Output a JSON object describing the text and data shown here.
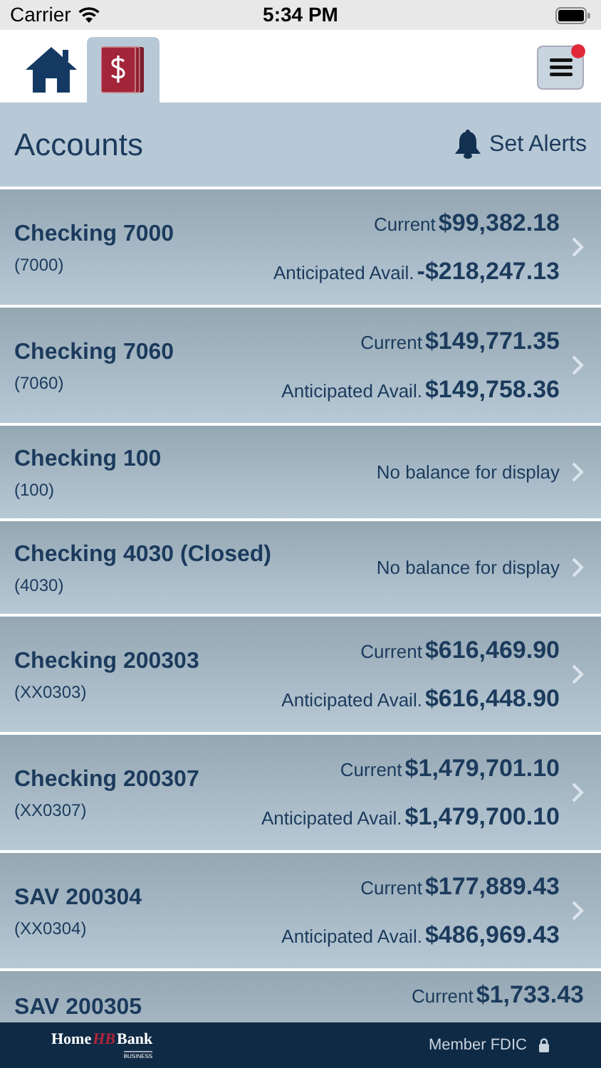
{
  "status_bar": {
    "carrier": "Carrier",
    "time": "5:34 PM"
  },
  "nav": {
    "tabs": [
      {
        "kind": "home",
        "selected": false
      },
      {
        "kind": "accounts",
        "selected": true
      }
    ],
    "menu": {
      "notification": true
    }
  },
  "header": {
    "title": "Accounts",
    "alerts_label": "Set Alerts"
  },
  "accounts": [
    {
      "kind": "balances",
      "name": "Checking 7000",
      "number": "(7000)",
      "current_label": "Current",
      "current": "$99,382.18",
      "anticipated_label": "Anticipated Avail.",
      "anticipated": "-$218,247.13"
    },
    {
      "kind": "balances",
      "name": "Checking 7060",
      "number": "(7060)",
      "current_label": "Current",
      "current": "$149,771.35",
      "anticipated_label": "Anticipated Avail.",
      "anticipated": "$149,758.36"
    },
    {
      "kind": "message",
      "name": "Checking 100",
      "number": "(100)",
      "message": "No balance for display"
    },
    {
      "kind": "message",
      "name": "Checking 4030 (Closed)",
      "number": "(4030)",
      "message": "No balance for display"
    },
    {
      "kind": "balances",
      "name": "Checking 200303",
      "number": "(XX0303)",
      "current_label": "Current",
      "current": "$616,469.90",
      "anticipated_label": "Anticipated Avail.",
      "anticipated": "$616,448.90"
    },
    {
      "kind": "balances",
      "name": "Checking 200307",
      "number": "(XX0307)",
      "current_label": "Current",
      "current": "$1,479,701.10",
      "anticipated_label": "Anticipated Avail.",
      "anticipated": "$1,479,700.10"
    },
    {
      "kind": "balances",
      "name": "SAV 200304",
      "number": "(XX0304)",
      "current_label": "Current",
      "current": "$177,889.43",
      "anticipated_label": "Anticipated Avail.",
      "anticipated": "$486,969.43"
    },
    {
      "kind": "partial",
      "name": "SAV 200305",
      "current_label": "Current",
      "current": "$1,733.43"
    }
  ],
  "footer": {
    "logo": {
      "left": "Home",
      "mark": "HB",
      "right": "Bank",
      "tagline": "BUSINESS"
    },
    "fdic": "Member FDIC"
  }
}
